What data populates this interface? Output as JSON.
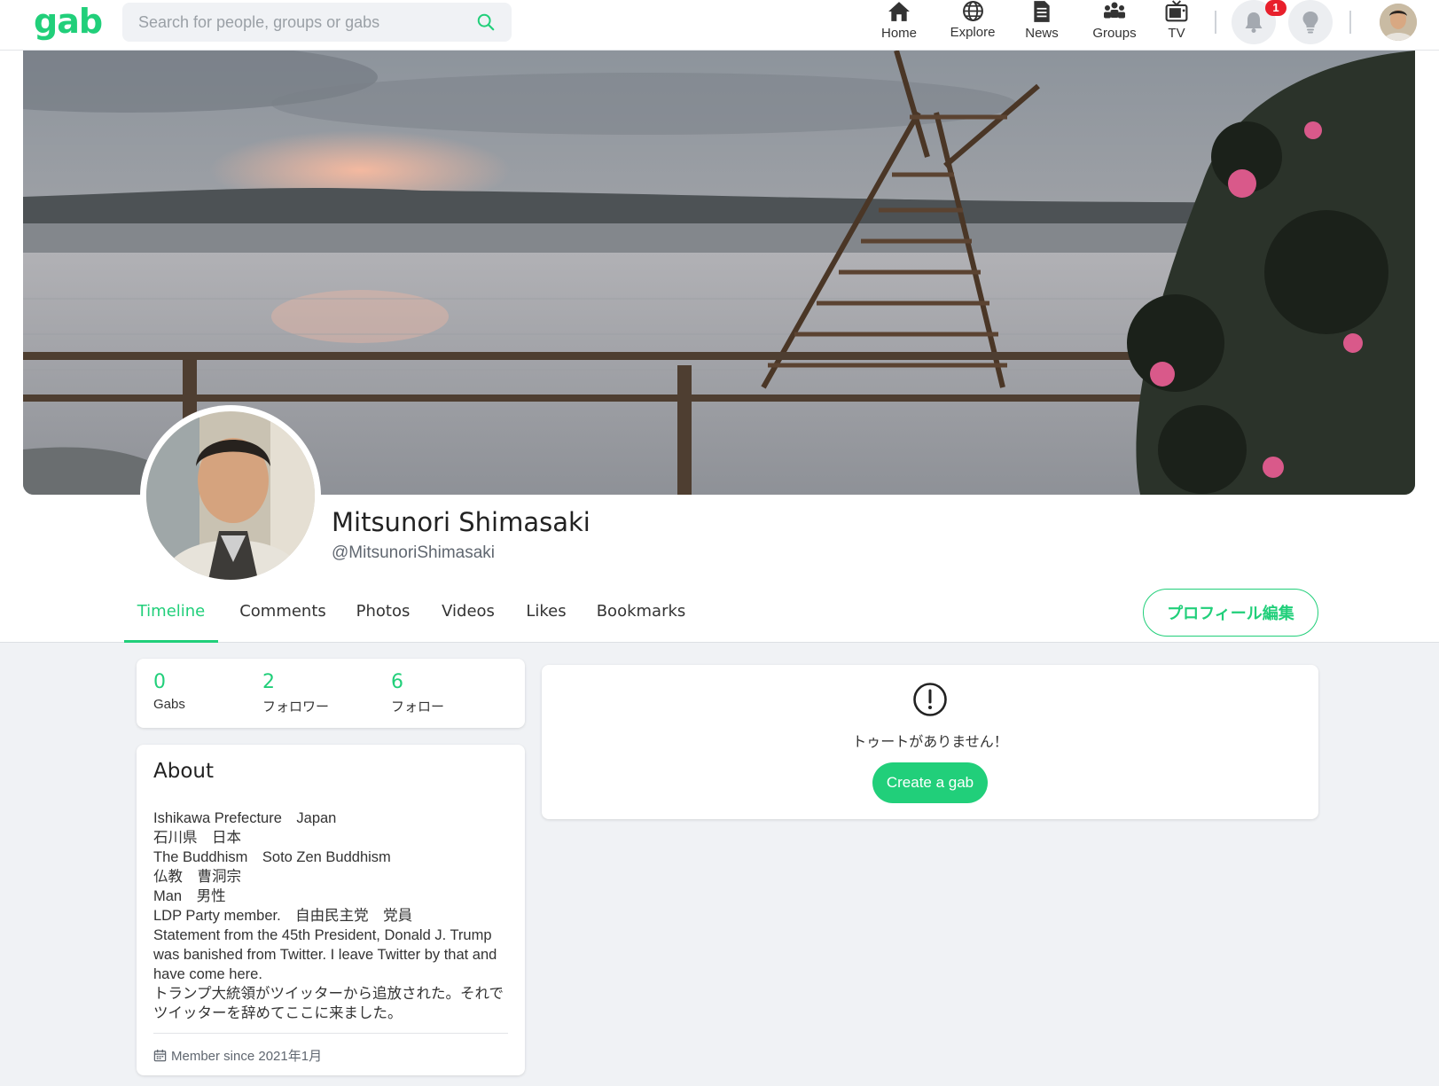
{
  "brand": {
    "logo": "gab",
    "accent": "#21cf7a"
  },
  "search": {
    "placeholder": "Search for people, groups or gabs",
    "value": ""
  },
  "nav": {
    "items": [
      {
        "label": "Home",
        "icon": "home-icon"
      },
      {
        "label": "Explore",
        "icon": "globe-icon"
      },
      {
        "label": "News",
        "icon": "news-icon"
      },
      {
        "label": "Groups",
        "icon": "groups-icon"
      },
      {
        "label": "TV",
        "icon": "tv-icon"
      }
    ],
    "notifications_count": "1"
  },
  "profile": {
    "display_name": "Mitsunori Shimasaki",
    "handle": "@MitsunoriShimasaki",
    "edit_button": "プロフィール編集"
  },
  "tabs": [
    "Timeline",
    "Comments",
    "Photos",
    "Videos",
    "Likes",
    "Bookmarks"
  ],
  "stats": {
    "gabs": {
      "value": "0",
      "label": "Gabs"
    },
    "followers": {
      "value": "2",
      "label": "フォロワー"
    },
    "following": {
      "value": "6",
      "label": "フォロー"
    }
  },
  "about": {
    "title": "About",
    "bio": "Ishikawa Prefecture　Japan\n石川県　日本\nThe Buddhism　Soto Zen Buddhism\n仏教　曹洞宗\nMan　男性\nLDP Party member.　自由民主党　党員\nStatement from the 45th President, Donald J. Trump was banished from Twitter. I leave Twitter by that and have come here.\nトランプ大統領がツイッターから追放された。それでツイッターを辞めてここに来ました。",
    "member_since": "Member since 2021年1月"
  },
  "timeline": {
    "empty_message": "トゥートがありません！",
    "create_button": "Create a gab"
  }
}
